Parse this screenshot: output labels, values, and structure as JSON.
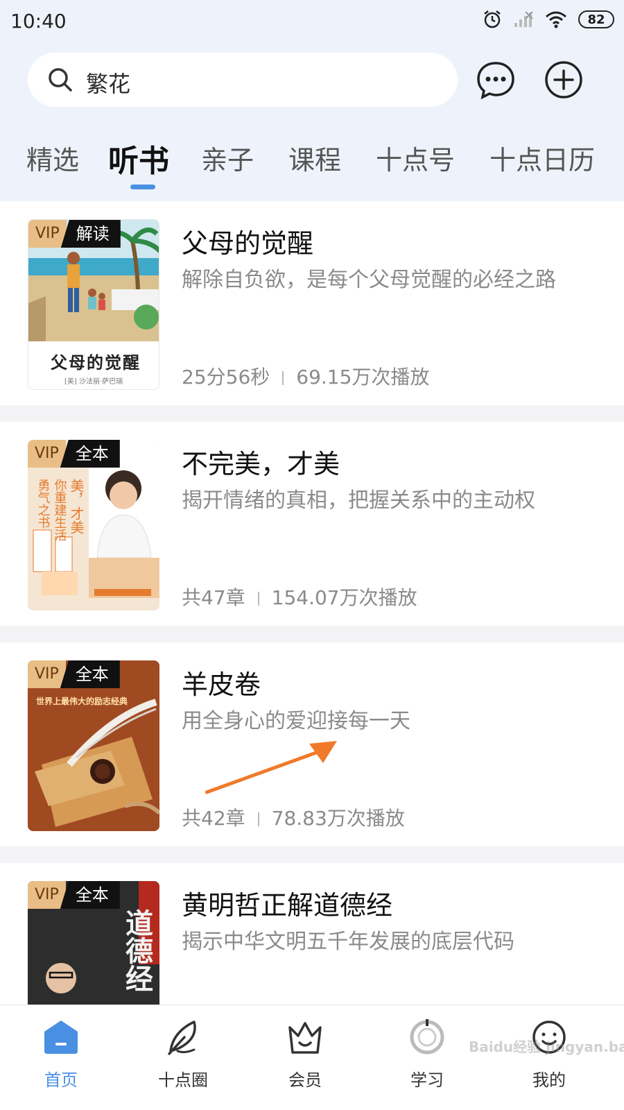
{
  "status_bar": {
    "time": "10:40",
    "battery": "82"
  },
  "search": {
    "text": "繁花"
  },
  "tabs": [
    {
      "label": "精选"
    },
    {
      "label": "听书",
      "active": true
    },
    {
      "label": "亲子"
    },
    {
      "label": "课程"
    },
    {
      "label": "十点号"
    },
    {
      "label": "十点日历"
    }
  ],
  "books": [
    {
      "badge_vip": "VIP",
      "badge_type": "解读",
      "cover_title": "父母的觉醒",
      "cover_author": "[美] 沙法丽·萨巴瑞",
      "title": "父母的觉醒",
      "subtitle": "解除自负欲，是每个父母觉醒的必经之路",
      "duration": "25分56秒",
      "plays": "69.15万次播放"
    },
    {
      "badge_vip": "VIP",
      "badge_type": "全本",
      "title": "不完美，才美",
      "subtitle": "揭开情绪的真相，把握关系中的主动权",
      "duration": "共47章",
      "plays": "154.07万次播放"
    },
    {
      "badge_vip": "VIP",
      "badge_type": "全本",
      "cover_caption": "世界上最伟大的励志经典",
      "title": "羊皮卷",
      "subtitle": "用全身心的爱迎接每一天",
      "duration": "共42章",
      "plays": "78.83万次播放"
    },
    {
      "badge_vip": "VIP",
      "badge_type": "全本",
      "cover_title": "道德经",
      "title": "黄明哲正解道德经",
      "subtitle": "揭示中华文明五千年发展的底层代码"
    }
  ],
  "bottom_nav": [
    {
      "label": "首页",
      "icon": "home-icon",
      "active": true
    },
    {
      "label": "十点圈",
      "icon": "feather-icon"
    },
    {
      "label": "会员",
      "icon": "crown-icon"
    },
    {
      "label": "学习",
      "icon": "study-icon"
    },
    {
      "label": "我的",
      "icon": "profile-icon"
    }
  ],
  "watermark": "Baidu经验 jingyan.baidu.com",
  "colors": {
    "accent": "#4a90e2",
    "vip": "#e9bd86",
    "arrow": "#f07a2a"
  }
}
